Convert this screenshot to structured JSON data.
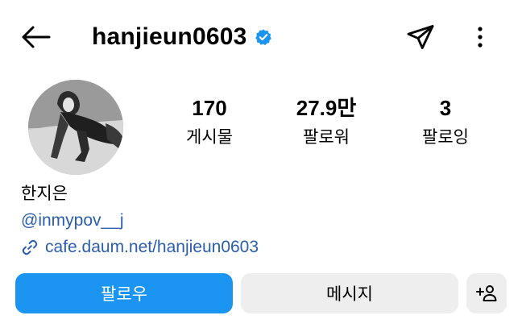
{
  "header": {
    "username": "hanjieun0603",
    "verified": true,
    "icons": {
      "back": "arrow-left-icon",
      "verified": "verified-badge-icon",
      "send": "paper-plane-icon",
      "more": "more-vertical-icon"
    }
  },
  "stats": {
    "posts": {
      "value": "170",
      "label": "게시물"
    },
    "followers": {
      "value": "27.9만",
      "label": "팔로워"
    },
    "following": {
      "value": "3",
      "label": "팔로잉"
    }
  },
  "bio": {
    "name": "한지은",
    "handle": "@inmypov__j",
    "link": "cafe.daum.net/hanjieun0603",
    "link_icon": "link-icon"
  },
  "actions": {
    "follow_label": "팔로우",
    "message_label": "메시지",
    "suggest_icon": "add-person-icon"
  },
  "colors": {
    "primary": "#1b95f1",
    "link": "#2a5db0",
    "verified": "#1b95f1",
    "secondary_button": "#eeeeee"
  }
}
